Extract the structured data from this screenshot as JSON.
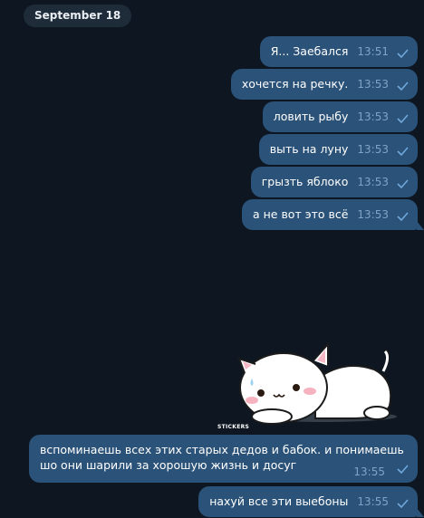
{
  "chat": {
    "date_label": "September 18",
    "messages": [
      {
        "text": "Я... Заебался",
        "time": "13:51"
      },
      {
        "text": "хочется на речку.",
        "time": "13:53"
      },
      {
        "text": "ловить рыбу",
        "time": "13:53"
      },
      {
        "text": "выть на луну",
        "time": "13:53"
      },
      {
        "text": "грызть яблоко",
        "time": "13:53"
      },
      {
        "text": "а не вот это всё",
        "time": "13:53"
      }
    ],
    "sticker": {
      "icon": "cat-sticker",
      "caption": "STICKERS"
    },
    "long_message": {
      "text": "вспоминаешь всех этих старых дедов и бабок. и понимаешь шо они шарили за хорошую жизнь и досуг",
      "time": "13:55"
    },
    "last_message": {
      "text": "нахуй все эти выебоны",
      "time": "13:55"
    }
  },
  "colors": {
    "background": "#0e1621",
    "outgoing_bubble": "#2b5278",
    "date_pill": "#1e2c3a",
    "time_text": "#7ea3c6"
  }
}
